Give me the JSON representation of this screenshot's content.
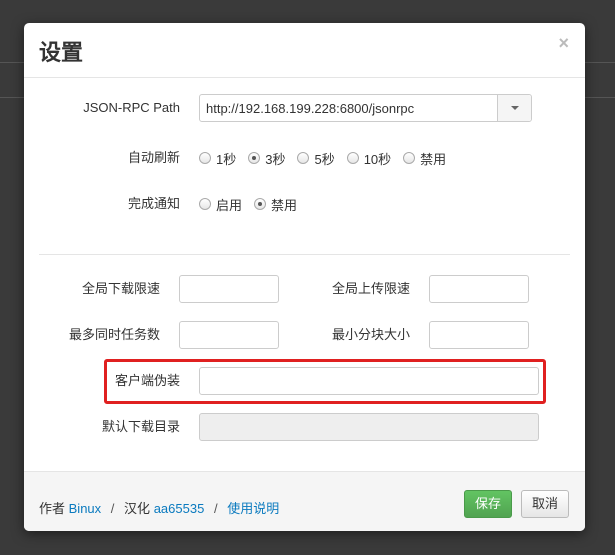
{
  "dialog": {
    "title": "设置",
    "close_symbol": "×"
  },
  "rpc": {
    "label": "JSON-RPC Path",
    "value": "http://192.168.199.228:6800/jsonrpc",
    "dropdown_icon": "caret-down-icon"
  },
  "refresh": {
    "label": "自动刷新",
    "options": [
      "1秒",
      "3秒",
      "5秒",
      "10秒",
      "禁用"
    ],
    "selected": "3秒"
  },
  "notify": {
    "label": "完成通知",
    "options": [
      "启用",
      "禁用"
    ],
    "selected": "禁用"
  },
  "limits": {
    "download_label": "全局下载限速",
    "download_value": "",
    "upload_label": "全局上传限速",
    "upload_value": "",
    "max_tasks_label": "最多同时任务数",
    "max_tasks_value": "",
    "min_split_label": "最小分块大小",
    "min_split_value": ""
  },
  "client": {
    "useragent_label": "客户端伪装",
    "useragent_value": "",
    "dir_label": "默认下载目录",
    "dir_value": ""
  },
  "footer": {
    "author_prefix": "作者",
    "author_name": "Binux",
    "sep1": "/",
    "translator_prefix": "汉化",
    "translator_name": "aa65535",
    "sep2": "/",
    "help_link": "使用说明",
    "save_label": "保存",
    "cancel_label": "取消"
  },
  "colors": {
    "save_button": "#5bb75b",
    "link": "#0a7abf",
    "highlight_border": "#e02020"
  }
}
